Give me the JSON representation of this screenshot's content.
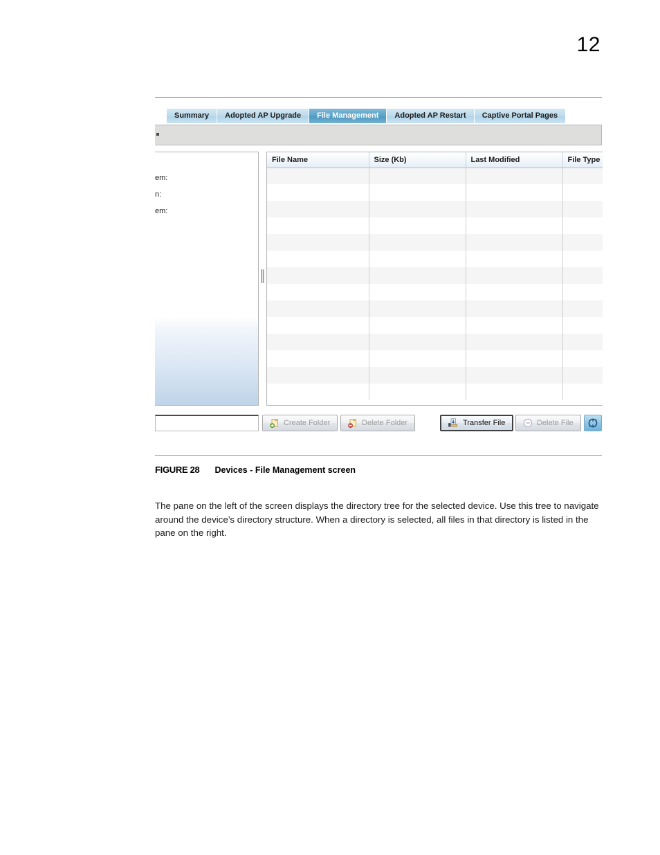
{
  "page": {
    "number": "12"
  },
  "figure": {
    "tabs": [
      {
        "label": "Summary",
        "active": false
      },
      {
        "label": "Adopted AP Upgrade",
        "active": false
      },
      {
        "label": "File Management",
        "active": true
      },
      {
        "label": "Adopted AP Restart",
        "active": false
      },
      {
        "label": "Captive Portal Pages",
        "active": false
      }
    ],
    "tree_pane": {
      "labels": [
        "em:",
        "n:",
        "em:"
      ]
    },
    "file_table": {
      "columns": [
        "File Name",
        "Size (Kb)",
        "Last Modified",
        "File Type"
      ],
      "rows": [
        [
          "",
          "",
          "",
          ""
        ],
        [
          "",
          "",
          "",
          ""
        ],
        [
          "",
          "",
          "",
          ""
        ],
        [
          "",
          "",
          "",
          ""
        ],
        [
          "",
          "",
          "",
          ""
        ],
        [
          "",
          "",
          "",
          ""
        ],
        [
          "",
          "",
          "",
          ""
        ],
        [
          "",
          "",
          "",
          ""
        ],
        [
          "",
          "",
          "",
          ""
        ],
        [
          "",
          "",
          "",
          ""
        ],
        [
          "",
          "",
          "",
          ""
        ],
        [
          "",
          "",
          "",
          ""
        ],
        [
          "",
          "",
          "",
          ""
        ],
        [
          "",
          "",
          "",
          ""
        ]
      ]
    },
    "buttons": {
      "folder_name_value": "",
      "folder_name_placeholder": "",
      "create_folder": "Create Folder",
      "delete_folder": "Delete Folder",
      "transfer_file": "Transfer File",
      "delete_file": "Delete File",
      "refresh_icon": "refresh-icon"
    },
    "colors": {
      "tab_active": "#5ba2c6",
      "tab_inactive": "#bfdcec",
      "toolbar_gray": "#dededd",
      "refresh_button": "#8fc6e6",
      "row_stripe": "#f5f5f5"
    }
  },
  "caption": {
    "label": "FIGURE 28",
    "text": "Devices - File Management screen"
  },
  "paragraph": {
    "text": "The pane on the left of the screen displays the directory tree for the selected device. Use this tree to navigate around the device’s directory structure. When a directory is selected, all files in that directory is listed in the pane on the right."
  }
}
